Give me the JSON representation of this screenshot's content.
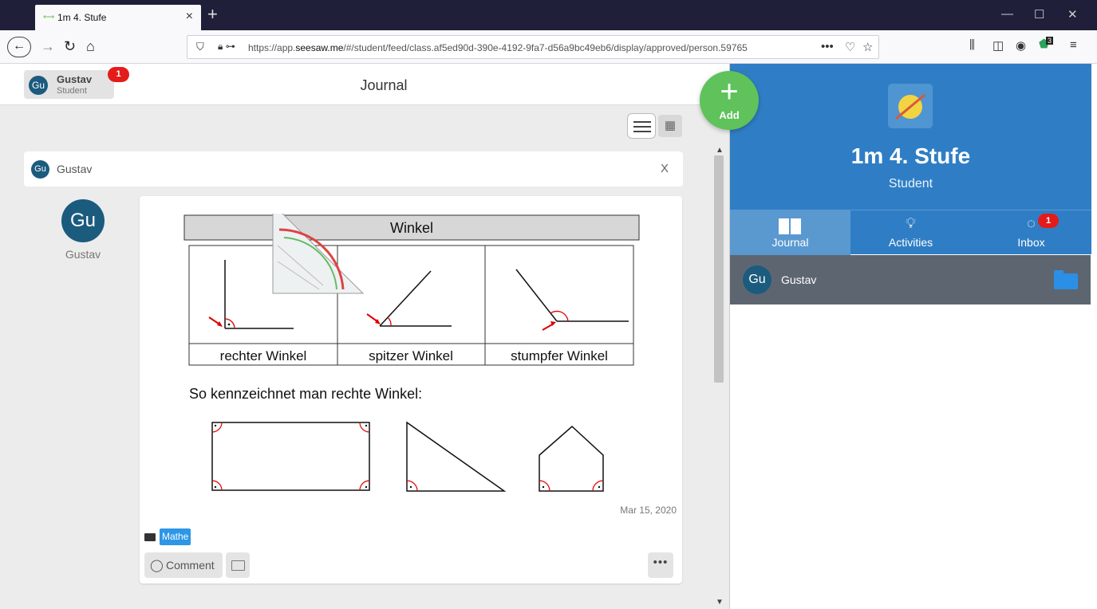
{
  "browser": {
    "tab_title": "1m 4. Stufe",
    "tab_close": "×",
    "new_tab": "+",
    "url_prefix": "https://app.",
    "url_domain": "seesaw.me",
    "url_rest": "/#/student/feed/class.af5ed90d-390e-4192-9fa7-d56a9bc49eb6/display/approved/person.59765",
    "page_actions": "•••",
    "extension_badge": "3"
  },
  "header": {
    "user_initials": "Gu",
    "user_name": "Gustav",
    "user_role": "Student",
    "notification_count": "1",
    "title": "Journal"
  },
  "post": {
    "author_initials": "Gu",
    "author_name": "Gustav",
    "close_label": "X",
    "date": "Mar 15, 2020",
    "folder_tag": "Mathe",
    "comment_label": "Comment",
    "more_label": "•••",
    "worksheet": {
      "title": "Winkel",
      "angles": [
        "rechter Winkel",
        "spitzer Winkel",
        "stumpfer Winkel"
      ],
      "caption": "So kennzeichnet man rechte Winkel:"
    }
  },
  "add_button": {
    "label": "Add"
  },
  "class_panel": {
    "class_name": "1m 4. Stufe",
    "role": "Student",
    "tabs": [
      {
        "label": "Journal"
      },
      {
        "label": "Activities"
      },
      {
        "label": "Inbox",
        "badge": "1"
      }
    ],
    "students": [
      {
        "initials": "Gu",
        "name": "Gustav"
      }
    ]
  },
  "colors": {
    "panel_blue": "#2f7ec5",
    "add_green": "#5fc25b",
    "avatar_blue": "#1b5b7e",
    "badge_red": "#e41b1b",
    "tag_blue": "#2d96e6"
  }
}
